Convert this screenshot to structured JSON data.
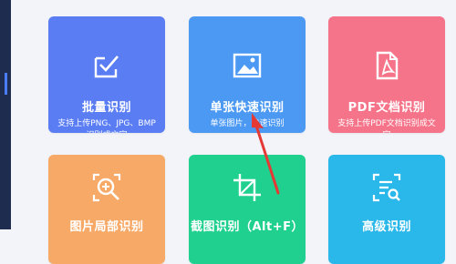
{
  "colors": {
    "batch": "#5a7df4",
    "single": "#4b99f3",
    "pdf": "#f57489",
    "partial": "#f7a968",
    "screenshot": "#1fd08e",
    "advanced": "#2ab8ea",
    "arrow": "#e53935"
  },
  "cards": [
    {
      "title": "批量识别",
      "desc": "支持上传PNG、JPG、BMP识别成文字",
      "icon": "check-square-icon"
    },
    {
      "title": "单张快速识别",
      "desc": "单张图片，快速识别",
      "icon": "image-icon"
    },
    {
      "title": "PDF文档识别",
      "desc": "支持上传PDF文档识别成文字",
      "icon": "pdf-file-icon"
    },
    {
      "title": "图片局部识别",
      "icon": "zoom-plus-icon"
    },
    {
      "title": "截图识别（Alt+F）",
      "icon": "crop-icon"
    },
    {
      "title": "高级识别",
      "icon": "scan-document-icon"
    }
  ]
}
